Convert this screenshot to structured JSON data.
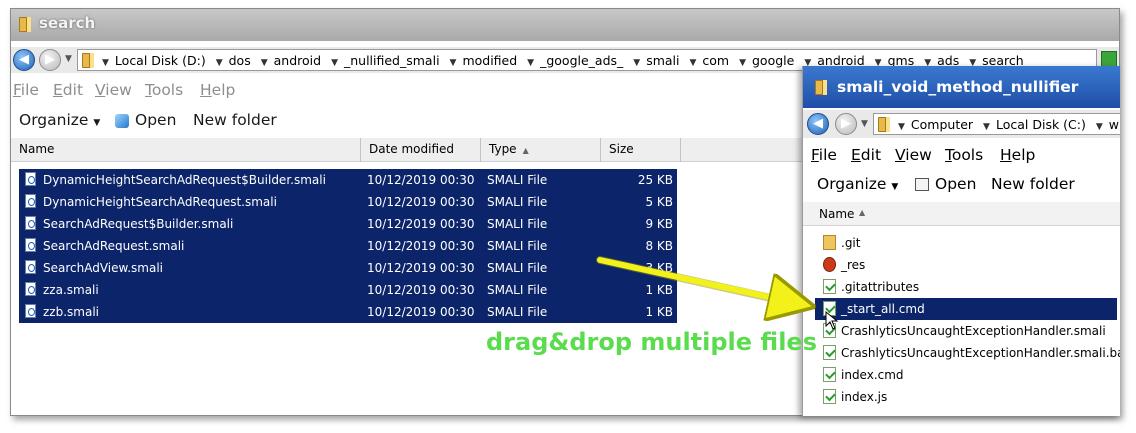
{
  "left_window": {
    "title": "search",
    "breadcrumbs": [
      "Local Disk (D:)",
      "dos",
      "android",
      "_nullified_smali",
      "modified",
      "_google_ads_",
      "smali",
      "com",
      "google",
      "android",
      "gms",
      "ads",
      "search"
    ],
    "menu": [
      "File",
      "Edit",
      "View",
      "Tools",
      "Help"
    ],
    "toolbar": {
      "organize": "Organize",
      "open": "Open",
      "new_folder": "New folder"
    },
    "columns": {
      "name": "Name",
      "date": "Date modified",
      "type": "Type",
      "size": "Size"
    },
    "files": [
      {
        "name": "DynamicHeightSearchAdRequest$Builder.smali",
        "date": "10/12/2019 00:30",
        "type": "SMALI File",
        "size": "25 KB"
      },
      {
        "name": "DynamicHeightSearchAdRequest.smali",
        "date": "10/12/2019 00:30",
        "type": "SMALI File",
        "size": "5 KB"
      },
      {
        "name": "SearchAdRequest$Builder.smali",
        "date": "10/12/2019 00:30",
        "type": "SMALI File",
        "size": "9 KB"
      },
      {
        "name": "SearchAdRequest.smali",
        "date": "10/12/2019 00:30",
        "type": "SMALI File",
        "size": "8 KB"
      },
      {
        "name": "SearchAdView.smali",
        "date": "10/12/2019 00:30",
        "type": "SMALI File",
        "size": "3 KB"
      },
      {
        "name": "zza.smali",
        "date": "10/12/2019 00:30",
        "type": "SMALI File",
        "size": "1 KB"
      },
      {
        "name": "zzb.smali",
        "date": "10/12/2019 00:30",
        "type": "SMALI File",
        "size": "1 KB"
      }
    ]
  },
  "right_window": {
    "title": "smali_void_method_nullifier",
    "breadcrumbs": [
      "Computer",
      "Local Disk (C:)",
      "w"
    ],
    "menu": [
      "File",
      "Edit",
      "View",
      "Tools",
      "Help"
    ],
    "toolbar": {
      "organize": "Organize",
      "open": "Open",
      "new_folder": "New folder"
    },
    "columns": {
      "name": "Name"
    },
    "items": [
      {
        "name": ".git",
        "icon": "folder-icon"
      },
      {
        "name": "_res",
        "icon": "resource-icon"
      },
      {
        "name": ".gitattributes",
        "icon": "checked-file-icon"
      },
      {
        "name": "_start_all.cmd",
        "icon": "cmd-file-icon"
      },
      {
        "name": "CrashlyticsUncaughtExceptionHandler.smali",
        "icon": "checked-file-icon"
      },
      {
        "name": "CrashlyticsUncaughtExceptionHandler.smali.bak",
        "icon": "checked-file-icon"
      },
      {
        "name": "index.cmd",
        "icon": "cmd-file-icon"
      },
      {
        "name": "index.js",
        "icon": "checked-file-icon"
      }
    ]
  },
  "annotation": {
    "text": "drag&drop multiple files"
  },
  "colors": {
    "selection": "#0c246a",
    "annotation_text": "#5bdc4f",
    "arrow": "#f2f21a"
  }
}
